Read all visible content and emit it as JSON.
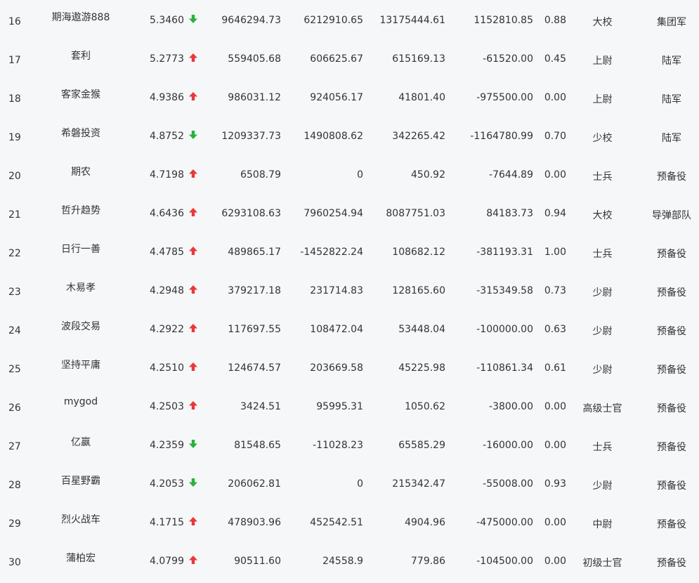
{
  "colors": {
    "up": "#e8393a",
    "down": "#27b33b",
    "background": "#f6f7f9",
    "text": "#333333"
  },
  "rows": [
    {
      "rank": "16",
      "name": "期海遨游888",
      "score": "5.3460",
      "trend": "down",
      "v1": "9646294.73",
      "v2": "6212910.65",
      "v3": "13175444.61",
      "v4": "1152810.85",
      "ratio": "0.88",
      "rank_title": "大校",
      "unit": "集团军"
    },
    {
      "rank": "17",
      "name": "套利",
      "score": "5.2773",
      "trend": "up",
      "v1": "559405.68",
      "v2": "606625.67",
      "v3": "615169.13",
      "v4": "-61520.00",
      "ratio": "0.45",
      "rank_title": "上尉",
      "unit": "陆军"
    },
    {
      "rank": "18",
      "name": "客家金猴",
      "score": "4.9386",
      "trend": "up",
      "v1": "986031.12",
      "v2": "924056.17",
      "v3": "41801.40",
      "v4": "-975500.00",
      "ratio": "0.00",
      "rank_title": "上尉",
      "unit": "陆军"
    },
    {
      "rank": "19",
      "name": "希磐投资",
      "score": "4.8752",
      "trend": "down",
      "v1": "1209337.73",
      "v2": "1490808.62",
      "v3": "342265.42",
      "v4": "-1164780.99",
      "ratio": "0.70",
      "rank_title": "少校",
      "unit": "陆军"
    },
    {
      "rank": "20",
      "name": "期农",
      "score": "4.7198",
      "trend": "up",
      "v1": "6508.79",
      "v2": "0",
      "v3": "450.92",
      "v4": "-7644.89",
      "ratio": "0.00",
      "rank_title": "士兵",
      "unit": "预备役"
    },
    {
      "rank": "21",
      "name": "哲升趋势",
      "score": "4.6436",
      "trend": "up",
      "v1": "6293108.63",
      "v2": "7960254.94",
      "v3": "8087751.03",
      "v4": "84183.73",
      "ratio": "0.94",
      "rank_title": "大校",
      "unit": "导弹部队"
    },
    {
      "rank": "22",
      "name": "日行一善",
      "score": "4.4785",
      "trend": "up",
      "v1": "489865.17",
      "v2": "-1452822.24",
      "v3": "108682.12",
      "v4": "-381193.31",
      "ratio": "1.00",
      "rank_title": "士兵",
      "unit": "预备役"
    },
    {
      "rank": "23",
      "name": "木易孝",
      "score": "4.2948",
      "trend": "up",
      "v1": "379217.18",
      "v2": "231714.83",
      "v3": "128165.60",
      "v4": "-315349.58",
      "ratio": "0.73",
      "rank_title": "少尉",
      "unit": "预备役"
    },
    {
      "rank": "24",
      "name": "波段交易",
      "score": "4.2922",
      "trend": "up",
      "v1": "117697.55",
      "v2": "108472.04",
      "v3": "53448.04",
      "v4": "-100000.00",
      "ratio": "0.63",
      "rank_title": "少尉",
      "unit": "预备役"
    },
    {
      "rank": "25",
      "name": "坚持平庸",
      "score": "4.2510",
      "trend": "up",
      "v1": "124674.57",
      "v2": "203669.58",
      "v3": "45225.98",
      "v4": "-110861.34",
      "ratio": "0.61",
      "rank_title": "少尉",
      "unit": "预备役"
    },
    {
      "rank": "26",
      "name": "mygod",
      "score": "4.2503",
      "trend": "up",
      "v1": "3424.51",
      "v2": "95995.31",
      "v3": "1050.62",
      "v4": "-3800.00",
      "ratio": "0.00",
      "rank_title": "高级士官",
      "unit": "预备役"
    },
    {
      "rank": "27",
      "name": "亿赢",
      "score": "4.2359",
      "trend": "down",
      "v1": "81548.65",
      "v2": "-11028.23",
      "v3": "65585.29",
      "v4": "-16000.00",
      "ratio": "0.00",
      "rank_title": "士兵",
      "unit": "预备役"
    },
    {
      "rank": "28",
      "name": "百星野霸",
      "score": "4.2053",
      "trend": "down",
      "v1": "206062.81",
      "v2": "0",
      "v3": "215342.47",
      "v4": "-55008.00",
      "ratio": "0.93",
      "rank_title": "少尉",
      "unit": "预备役"
    },
    {
      "rank": "29",
      "name": "烈火战车",
      "score": "4.1715",
      "trend": "up",
      "v1": "478903.96",
      "v2": "452542.51",
      "v3": "4904.96",
      "v4": "-475000.00",
      "ratio": "0.00",
      "rank_title": "中尉",
      "unit": "预备役"
    },
    {
      "rank": "30",
      "name": "蒲柏宏",
      "score": "4.0799",
      "trend": "up",
      "v1": "90511.60",
      "v2": "24558.9",
      "v3": "779.86",
      "v4": "-104500.00",
      "ratio": "0.00",
      "rank_title": "初级士官",
      "unit": "预备役"
    }
  ]
}
